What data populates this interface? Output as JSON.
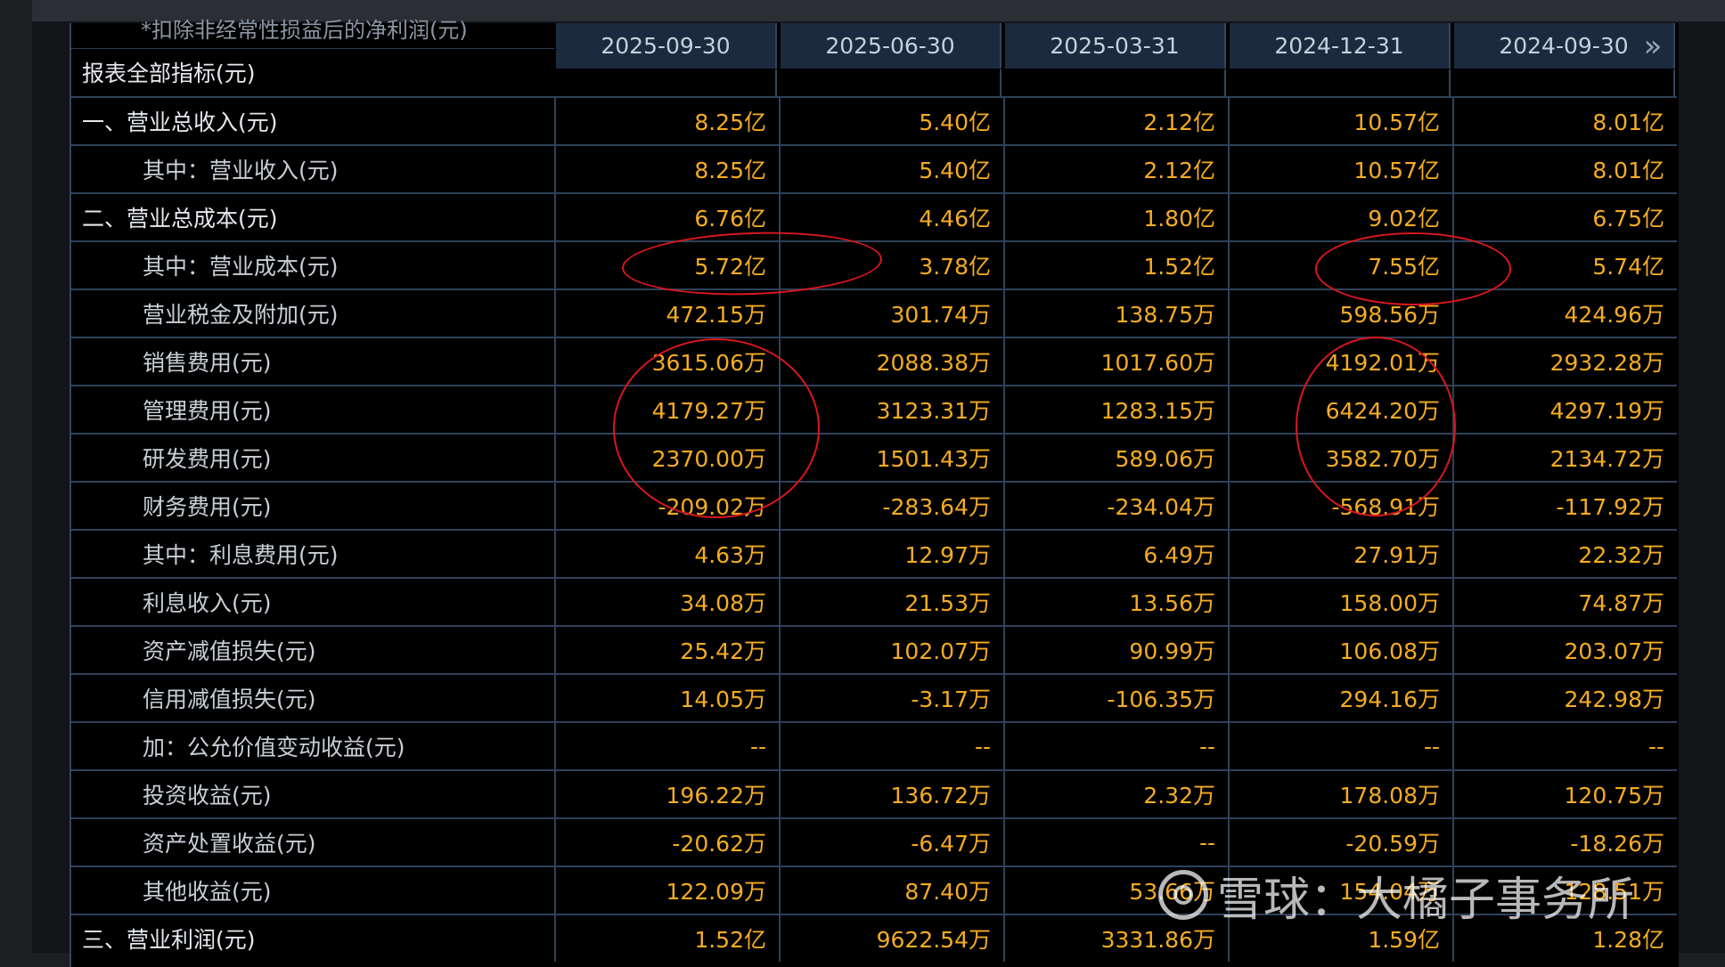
{
  "truncated_top_label": "*扣除非经常性损益后的净利润(元)",
  "header": {
    "left_title": "报表全部指标(元)",
    "periods": [
      "2025-09-30",
      "2025-06-30",
      "2025-03-31",
      "2024-12-31",
      "2024-09-30"
    ],
    "more_icon": "double-chevron-right-icon"
  },
  "rows": [
    {
      "label": "一、营业总收入(元)",
      "level": 0,
      "values": [
        "8.25亿",
        "5.40亿",
        "2.12亿",
        "10.57亿",
        "8.01亿"
      ]
    },
    {
      "label": "其中：营业收入(元)",
      "level": 1,
      "values": [
        "8.25亿",
        "5.40亿",
        "2.12亿",
        "10.57亿",
        "8.01亿"
      ]
    },
    {
      "label": "二、营业总成本(元)",
      "level": 0,
      "values": [
        "6.76亿",
        "4.46亿",
        "1.80亿",
        "9.02亿",
        "6.75亿"
      ]
    },
    {
      "label": "其中：营业成本(元)",
      "level": 1,
      "values": [
        "5.72亿",
        "3.78亿",
        "1.52亿",
        "7.55亿",
        "5.74亿"
      ]
    },
    {
      "label": "营业税金及附加(元)",
      "level": 1,
      "values": [
        "472.15万",
        "301.74万",
        "138.75万",
        "598.56万",
        "424.96万"
      ]
    },
    {
      "label": "销售费用(元)",
      "level": 1,
      "values": [
        "3615.06万",
        "2088.38万",
        "1017.60万",
        "4192.01万",
        "2932.28万"
      ]
    },
    {
      "label": "管理费用(元)",
      "level": 1,
      "values": [
        "4179.27万",
        "3123.31万",
        "1283.15万",
        "6424.20万",
        "4297.19万"
      ]
    },
    {
      "label": "研发费用(元)",
      "level": 1,
      "values": [
        "2370.00万",
        "1501.43万",
        "589.06万",
        "3582.70万",
        "2134.72万"
      ]
    },
    {
      "label": "财务费用(元)",
      "level": 1,
      "values": [
        "-209.02万",
        "-283.64万",
        "-234.04万",
        "-568.91万",
        "-117.92万"
      ]
    },
    {
      "label": "其中：利息费用(元)",
      "level": 1,
      "values": [
        "4.63万",
        "12.97万",
        "6.49万",
        "27.91万",
        "22.32万"
      ]
    },
    {
      "label": "利息收入(元)",
      "level": 1,
      "values": [
        "34.08万",
        "21.53万",
        "13.56万",
        "158.00万",
        "74.87万"
      ]
    },
    {
      "label": "资产减值损失(元)",
      "level": 1,
      "values": [
        "25.42万",
        "102.07万",
        "90.99万",
        "106.08万",
        "203.07万"
      ]
    },
    {
      "label": "信用减值损失(元)",
      "level": 1,
      "values": [
        "14.05万",
        "-3.17万",
        "-106.35万",
        "294.16万",
        "242.98万"
      ]
    },
    {
      "label": "加：公允价值变动收益(元)",
      "level": 1,
      "values": [
        "--",
        "--",
        "--",
        "--",
        "--"
      ]
    },
    {
      "label": "投资收益(元)",
      "level": 1,
      "values": [
        "196.22万",
        "136.72万",
        "2.32万",
        "178.08万",
        "120.75万"
      ]
    },
    {
      "label": "资产处置收益(元)",
      "level": 1,
      "values": [
        "-20.62万",
        "-6.47万",
        "--",
        "-20.59万",
        "-18.26万"
      ]
    },
    {
      "label": "其他收益(元)",
      "level": 1,
      "values": [
        "122.09万",
        "87.40万",
        "53.66万",
        "154.04万",
        "128.51万"
      ]
    },
    {
      "label": "三、营业利润(元)",
      "level": 0,
      "values": [
        "1.52亿",
        "9622.54万",
        "3331.86万",
        "1.59亿",
        "1.28亿"
      ]
    }
  ],
  "watermark": {
    "text": "雪球：大橘子事务所"
  },
  "colors": {
    "value": "#f5ac22",
    "annotation": "#d9171d",
    "header_bg": "#1b2a3e"
  }
}
